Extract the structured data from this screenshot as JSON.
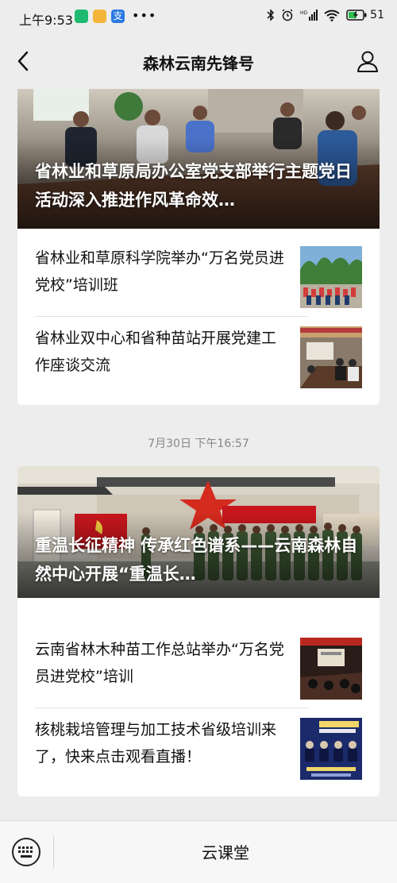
{
  "status_bar": {
    "time": "上午9:53",
    "more": "•••",
    "app_glyph_3": "支",
    "battery": "51"
  },
  "nav": {
    "title": "森林云南先锋号",
    "back_icon": "chevron-left-icon",
    "user_icon": "user-icon"
  },
  "feed": [
    {
      "hero_title": "省林业和草原局办公室党支部举行主题党日活动深入推进作风革命效…",
      "items": [
        {
          "title": "省林业和草原科学院举办“万名党员进党校”培训班"
        },
        {
          "title": "省林业双中心和省种苗站开展党建工作座谈交流"
        }
      ]
    },
    {
      "timestamp": "7月30日 下午16:57",
      "hero_title": "重温长征精神 传承红色谱系——云南森林自然中心开展“重温长…",
      "items": [
        {
          "title": "云南省林木种苗工作总站举办“万名党员进党校”培训"
        },
        {
          "title": "核桃栽培管理与加工技术省级培训来了，快来点击观看直播！"
        }
      ]
    }
  ],
  "bottom_bar": {
    "keyboard_icon": "keyboard-icon",
    "menu_label": "云课堂"
  },
  "colors": {
    "background": "#ededed",
    "card": "#ffffff",
    "text": "#111111",
    "timestamp": "#888888",
    "flag_red": "#c8161d"
  }
}
